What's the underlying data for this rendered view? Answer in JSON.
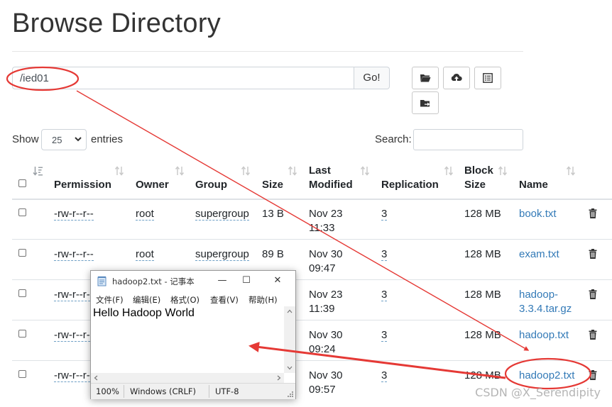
{
  "page": {
    "title": "Browse Directory"
  },
  "pathbar": {
    "value": "/ied01",
    "go_label": "Go!"
  },
  "toolbar": {
    "icons": [
      "folder-open-icon",
      "upload-icon",
      "list-icon",
      "folder-move-icon"
    ]
  },
  "length": {
    "show_label": "Show",
    "value": "25",
    "entries_label": "entries"
  },
  "search": {
    "label": "Search:",
    "value": ""
  },
  "table": {
    "headers": {
      "permission": "Permission",
      "owner": "Owner",
      "group": "Group",
      "size": "Size",
      "last_modified_1": "Last",
      "last_modified_2": "Modified",
      "replication": "Replication",
      "block_size_1": "Block",
      "block_size_2": "Size",
      "name": "Name"
    },
    "rows": [
      {
        "permission": "-rw-r--r--",
        "owner": "root",
        "group": "supergroup",
        "size": "13 B",
        "date": "Nov 23",
        "time": "11:33",
        "replication": "3",
        "block_size": "128 MB",
        "name_1": "book.txt",
        "name_2": ""
      },
      {
        "permission": "-rw-r--r--",
        "owner": "root",
        "group": "supergroup",
        "size": "89 B",
        "date": "Nov 30",
        "time": "09:47",
        "replication": "3",
        "block_size": "128 MB",
        "name_1": "exam.txt",
        "name_2": ""
      },
      {
        "permission": "-rw-r--r--",
        "owner": "",
        "group": "",
        "size": "",
        "date": "Nov 23",
        "time": "11:39",
        "replication": "3",
        "block_size": "128 MB",
        "name_1": "hadoop-",
        "name_2": "3.3.4.tar.gz"
      },
      {
        "permission": "-rw-r--r--",
        "owner": "",
        "group": "",
        "size": "",
        "date": "Nov 30",
        "time": "09:24",
        "replication": "3",
        "block_size": "128 MB",
        "name_1": "hadoop.txt",
        "name_2": ""
      },
      {
        "permission": "-rw-r--r--",
        "owner": "",
        "group": "",
        "size": "",
        "date": "Nov 30",
        "time": "09:57",
        "replication": "3",
        "block_size": "128 MB",
        "name_1": "hadoop2.txt",
        "name_2": ""
      }
    ]
  },
  "notepad": {
    "title": "hadoop2.txt - 记事本",
    "controls": {
      "minimize": "—",
      "maximize": "☐",
      "close": "✕"
    },
    "menu": [
      "文件(F)",
      "编辑(E)",
      "格式(O)",
      "查看(V)",
      "帮助(H)"
    ],
    "content": "Hello Hadoop World",
    "status": {
      "zoom": "100%",
      "line_ending": "Windows (CRLF)",
      "encoding": "UTF-8"
    }
  },
  "watermark": "CSDN @X_Serendipity",
  "colors": {
    "link": "#337ab7",
    "annotation": "#e53935",
    "text": "#212529"
  }
}
